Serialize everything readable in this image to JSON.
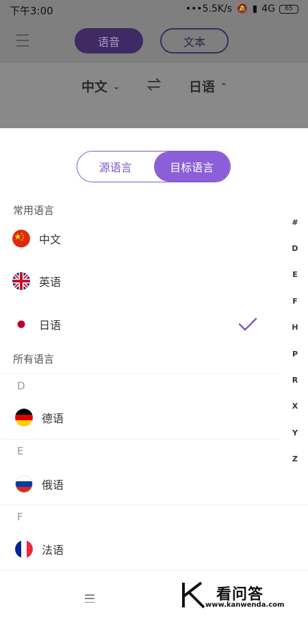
{
  "status": {
    "time": "下午3:00",
    "speed": "•••5.5K/s",
    "network": "4G",
    "battery": "65"
  },
  "header": {
    "voice_label": "语音",
    "text_label": "文本"
  },
  "lang_bar": {
    "source": "中文",
    "target": "日语"
  },
  "sheet": {
    "tabs": {
      "source": "源语言",
      "target": "目标语言",
      "active": "target"
    },
    "common_title": "常用语言",
    "common": [
      {
        "label": "中文",
        "flag": "china-flag-icon",
        "selected": false
      },
      {
        "label": "英语",
        "flag": "uk-flag-icon",
        "selected": false
      },
      {
        "label": "日语",
        "flag": "japan-flag-icon",
        "selected": true
      }
    ],
    "all_title": "所有语言",
    "groups": [
      {
        "letter": "D",
        "label": "德语",
        "flag": "germany-flag-icon"
      },
      {
        "letter": "E",
        "label": "俄语",
        "flag": "russia-flag-icon"
      },
      {
        "letter": "F",
        "label": "法语",
        "flag": "france-flag-icon"
      }
    ],
    "index": [
      "#",
      "D",
      "E",
      "F",
      "H",
      "P",
      "R",
      "X",
      "Y",
      "Z"
    ]
  },
  "watermark": {
    "title": "看问答",
    "url": "www.kanwenda.com"
  },
  "colors": {
    "accent": "#8a5fd8",
    "accent_border": "#7b55c9",
    "overlay_gray": "#7f7f7f"
  }
}
